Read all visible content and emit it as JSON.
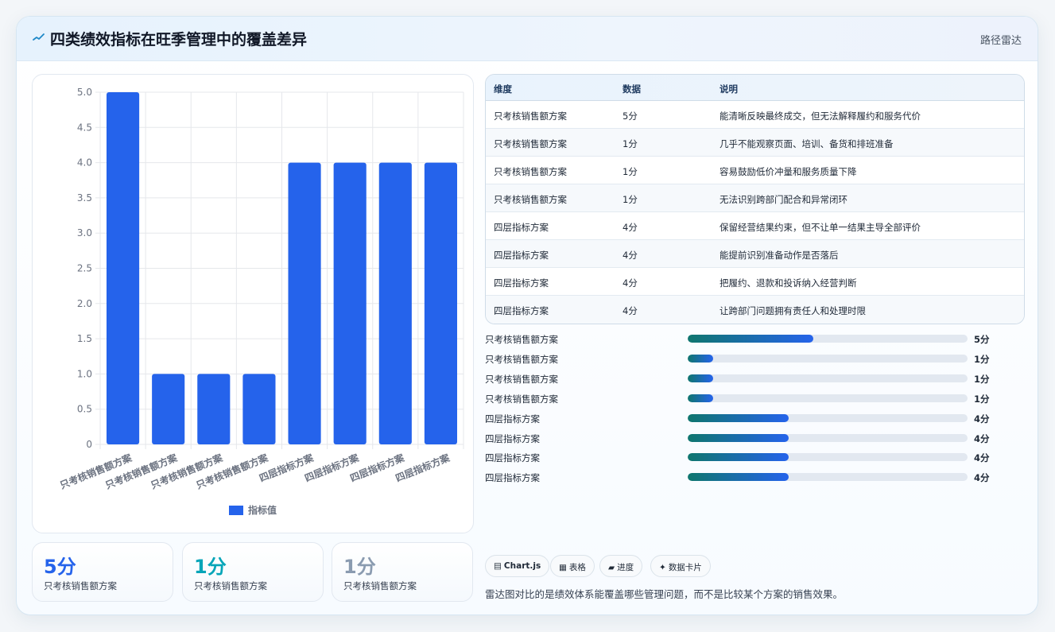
{
  "header": {
    "title": "四类绩效指标在旺季管理中的覆盖差异",
    "route_label": "路径雷达"
  },
  "chart_data": {
    "type": "bar",
    "categories": [
      "只考核销售额方案",
      "只考核销售额方案",
      "只考核销售额方案",
      "只考核销售额方案",
      "四层指标方案",
      "四层指标方案",
      "四层指标方案",
      "四层指标方案"
    ],
    "series": [
      {
        "name": "指标值",
        "values": [
          5,
          1,
          1,
          1,
          4,
          4,
          4,
          4
        ],
        "color": "#2563eb"
      }
    ],
    "ylim": [
      0,
      5
    ],
    "yticks": [
      "0",
      "0.5",
      "1.0",
      "1.5",
      "2.0",
      "2.5",
      "3.0",
      "3.5",
      "4.0",
      "4.5",
      "5.0"
    ],
    "grid": true,
    "legend": "bottom"
  },
  "stats": [
    {
      "value": "5分",
      "label": "只考核销售额方案",
      "color": "#2563eb"
    },
    {
      "value": "1分",
      "label": "只考核销售额方案",
      "color": "#06a5b8"
    },
    {
      "value": "1分",
      "label": "只考核销售额方案",
      "color": "#8a9bb0"
    }
  ],
  "table": {
    "headers": [
      "维度",
      "数据",
      "说明"
    ],
    "rows": [
      [
        "只考核销售额方案",
        "5分",
        "能清晰反映最终成交，但无法解释履约和服务代价"
      ],
      [
        "只考核销售额方案",
        "1分",
        "几乎不能观察页面、培训、备货和排班准备"
      ],
      [
        "只考核销售额方案",
        "1分",
        "容易鼓励低价冲量和服务质量下降"
      ],
      [
        "只考核销售额方案",
        "1分",
        "无法识别跨部门配合和异常闭环"
      ],
      [
        "四层指标方案",
        "4分",
        "保留经营结果约束，但不让单一结果主导全部评价"
      ],
      [
        "四层指标方案",
        "4分",
        "能提前识别准备动作是否落后"
      ],
      [
        "四层指标方案",
        "4分",
        "把履约、退款和投诉纳入经营判断"
      ],
      [
        "四层指标方案",
        "4分",
        "让跨部门问题拥有责任人和处理时限"
      ]
    ]
  },
  "progress": [
    {
      "label": "只考核销售额方案",
      "value": "5分",
      "fraction": 0.45
    },
    {
      "label": "只考核销售额方案",
      "value": "1分",
      "fraction": 0.09
    },
    {
      "label": "只考核销售额方案",
      "value": "1分",
      "fraction": 0.09
    },
    {
      "label": "只考核销售额方案",
      "value": "1分",
      "fraction": 0.09
    },
    {
      "label": "四层指标方案",
      "value": "4分",
      "fraction": 0.36
    },
    {
      "label": "四层指标方案",
      "value": "4分",
      "fraction": 0.36
    },
    {
      "label": "四层指标方案",
      "value": "4分",
      "fraction": 0.36
    },
    {
      "label": "四层指标方案",
      "value": "4分",
      "fraction": 0.36
    }
  ],
  "chips": [
    {
      "icon": "▤",
      "label": "Chart.js"
    },
    {
      "icon": "▦",
      "label": "表格"
    },
    {
      "icon": "▰",
      "label": "进度"
    },
    {
      "icon": "✦",
      "label": "数据卡片"
    }
  ],
  "note": "雷达图对比的是绩效体系能覆盖哪些管理问题，而不是比较某个方案的销售效果。"
}
